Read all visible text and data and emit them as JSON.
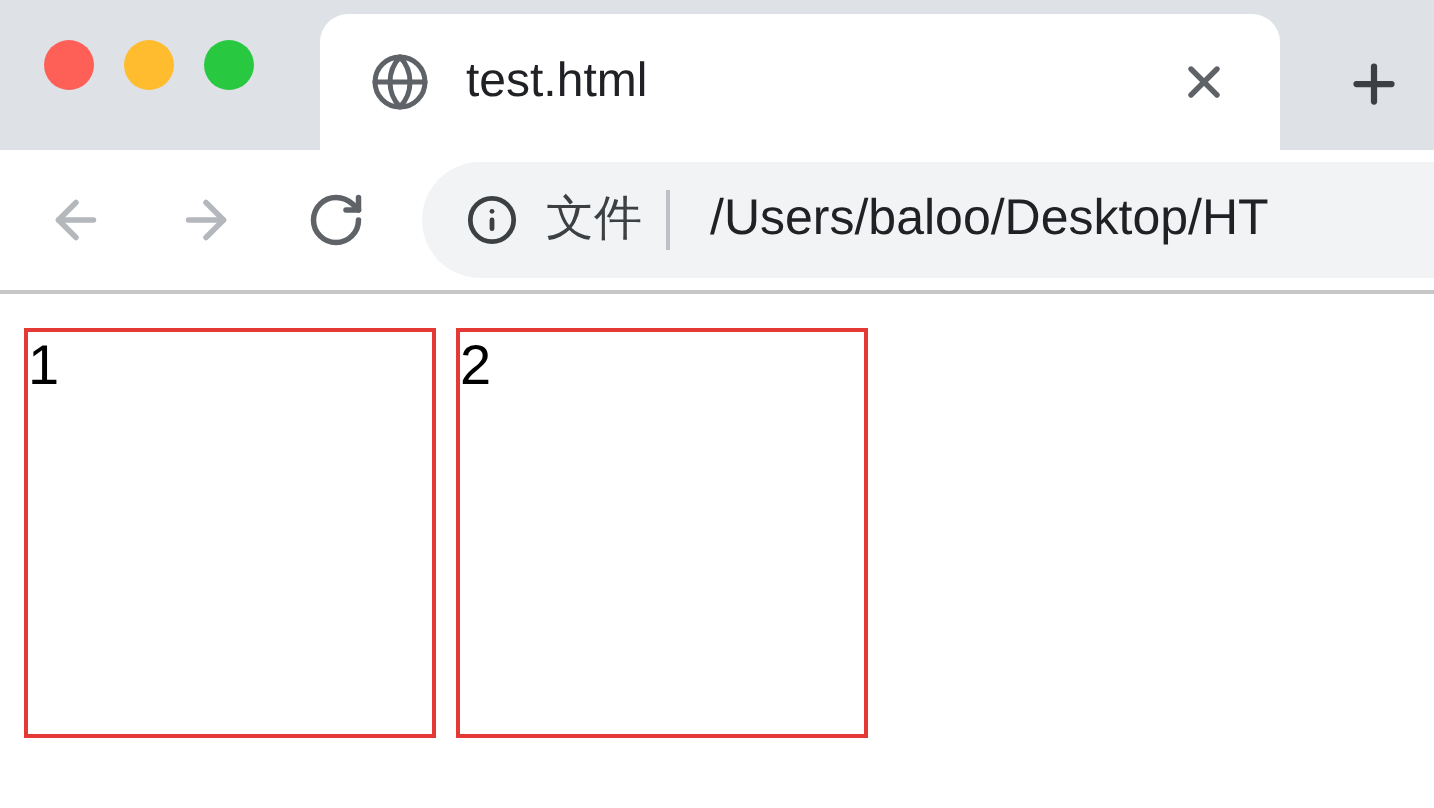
{
  "tab": {
    "title": "test.html",
    "selected": true
  },
  "toolbar": {
    "nav_buttons": [
      {
        "kind": "back",
        "disabled": true
      },
      {
        "kind": "forward",
        "disabled": true
      },
      {
        "kind": "reload",
        "disabled": false
      }
    ],
    "address": {
      "scheme_label": "文件",
      "url": "/Users/baloo/Desktop/HT"
    }
  },
  "page": {
    "boxes": [
      "1",
      "2"
    ]
  }
}
